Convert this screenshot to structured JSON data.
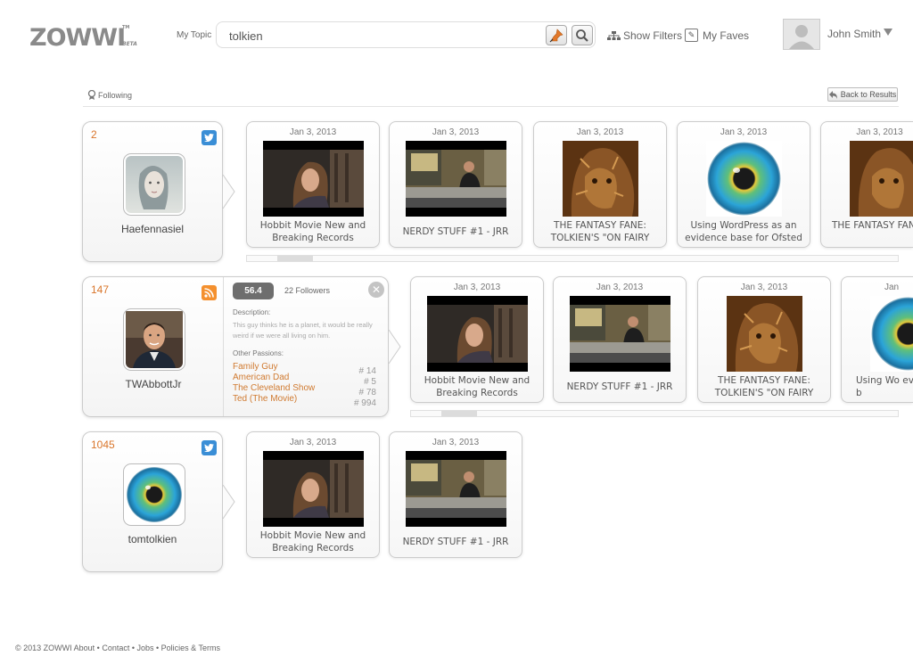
{
  "header": {
    "logo": "ZOWWI",
    "logo_tm": "TM",
    "logo_beta": "BETA",
    "topic_label": "My Topic",
    "search_value": "tolkien",
    "show_filters": "Show Filters",
    "my_faves": "My Faves",
    "user_name": "John Smith"
  },
  "subheader": {
    "following": "Following",
    "back": "Back to Results"
  },
  "profiles": [
    {
      "count": "2",
      "network": "twitter-icon",
      "name": "Haefennasiel",
      "videos": [
        {
          "date": "Jan 3, 2013",
          "title": "Hobbit Movie New and Breaking Records"
        },
        {
          "date": "Jan 3, 2013",
          "title": "NERDY STUFF #1 - JRR"
        },
        {
          "date": "Jan 3, 2013",
          "title": "THE FANTASY FANE: TOLKIEN'S \"ON FAIRY"
        },
        {
          "date": "Jan 3, 2013",
          "title": "Using WordPress as an evidence base for Ofsted"
        },
        {
          "date": "Jan 3, 2013",
          "title": "THE FANTASY FANE: TOLKIEN'S \"ON FAIRY"
        }
      ]
    },
    {
      "count": "147",
      "network": "rss-icon",
      "name": "TWAbbottJr",
      "score": "56.4",
      "followers": "22 Followers",
      "description_label": "Description:",
      "description": "This guy thinks he is a planet, it would be really weird if we were all living on him.",
      "passions_label": "Other Passions:",
      "passions": [
        {
          "name": "Family Guy",
          "rank": "# 14"
        },
        {
          "name": "American Dad",
          "rank": "# 5"
        },
        {
          "name": "The Cleveland Show",
          "rank": "# 78"
        },
        {
          "name": "Ted (The Movie)",
          "rank": "# 994"
        }
      ],
      "videos": [
        {
          "date": "Jan 3, 2013",
          "title": "Hobbit Movie New and Breaking Records"
        },
        {
          "date": "Jan 3, 2013",
          "title": "NERDY STUFF #1 - JRR"
        },
        {
          "date": "Jan 3, 2013",
          "title": "THE FANTASY FANE: TOLKIEN'S \"ON FAIRY"
        },
        {
          "date": "Jan",
          "title": "Using Wo evidence b"
        }
      ]
    },
    {
      "count": "1045",
      "network": "twitter-icon",
      "name": "tomtolkien",
      "videos": [
        {
          "date": "Jan 3, 2013",
          "title": "Hobbit Movie New and Breaking Records"
        },
        {
          "date": "Jan 3, 2013",
          "title": "NERDY STUFF #1 - JRR"
        }
      ]
    }
  ],
  "footer": "© 2013 ZOWWI   About • Contact • Jobs • Policies & Terms",
  "colors": {
    "accent_orange": "#d9752a",
    "twitter_blue": "#3a8ed6",
    "rss_orange": "#f4902e"
  }
}
